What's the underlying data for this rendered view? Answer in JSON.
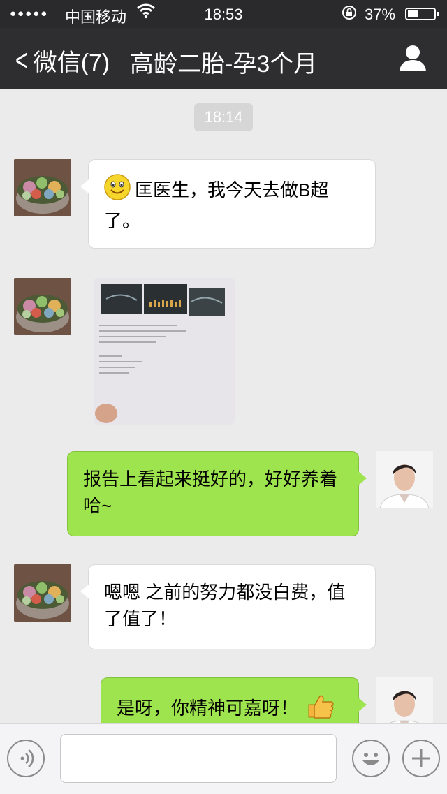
{
  "status_bar": {
    "signal": "●●●●●",
    "carrier": "中国移动",
    "time": "18:53",
    "battery": "37%"
  },
  "nav": {
    "back_label": "微信(7)",
    "title": "高龄二胎-孕3个月"
  },
  "chat": {
    "timestamp": "18:14",
    "messages": [
      {
        "from": "patient",
        "type": "text",
        "text": "匡医生，我今天去做B超了。"
      },
      {
        "from": "patient",
        "type": "image"
      },
      {
        "from": "doctor",
        "type": "text",
        "text": "报告上看起来挺好的，好好养着哈~"
      },
      {
        "from": "patient",
        "type": "text",
        "text": "嗯嗯 之前的努力都没白费，值了值了！"
      },
      {
        "from": "doctor",
        "type": "text",
        "text": "是呀，你精神可嘉呀！"
      }
    ]
  },
  "input_bar": {
    "value": ""
  },
  "colors": {
    "nav_bg": "#2e2e30",
    "chat_bg": "#ebebeb",
    "green_bubble": "#9ee44f",
    "white_bubble": "#ffffff"
  }
}
